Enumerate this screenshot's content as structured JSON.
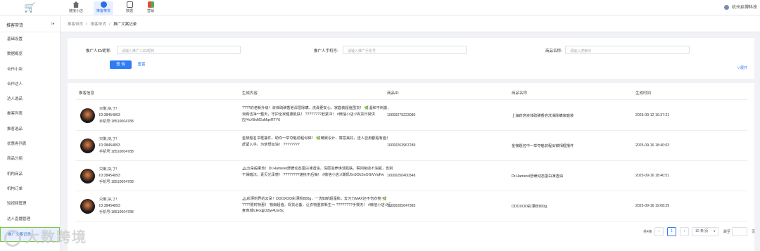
{
  "topbar": {
    "logo_icon": "cart-icon",
    "nav": [
      {
        "label": "链接小店",
        "icon": "home-icon"
      },
      {
        "label": "推客带货",
        "icon": "promo-icon",
        "active": true
      },
      {
        "label": "数据",
        "icon": "data-icon"
      },
      {
        "label": "营销",
        "icon": "marketing-icon"
      }
    ],
    "user_name": "杭州启博科技"
  },
  "sidebar": {
    "title": "推客带货",
    "collapse": "|◂",
    "items": [
      {
        "label": "基础设置"
      },
      {
        "label": "数据概览"
      },
      {
        "label": "合作小店"
      },
      {
        "label": "合作达人"
      },
      {
        "label": "达人选品"
      },
      {
        "label": "推客列表"
      },
      {
        "label": "推客选品"
      },
      {
        "label": "优惠券列表"
      },
      {
        "label": "商品分组"
      },
      {
        "label": "机构商品"
      },
      {
        "label": "机构订单"
      },
      {
        "label": "短视频管理"
      },
      {
        "label": "达人直播管理"
      },
      {
        "label": "推广文案记录",
        "active": true
      }
    ]
  },
  "breadcrumb": {
    "a": "推客带货",
    "sep": "/",
    "b": "推客带货",
    "c": "推广文案记录"
  },
  "filter": {
    "f1_label": "推广人ID/昵称:",
    "f1_placeholder": "请输入推广人ID/昵称",
    "f2_label": "推广人手机号:",
    "f2_placeholder": "请输入推广手机号",
    "f3_label": "商品名称:",
    "f3_placeholder": "请输入搜索ID",
    "query": "查 询",
    "reset": "重置",
    "expand": "∨展开"
  },
  "table": {
    "headers": [
      "推客信息",
      "生成内容",
      "商品ID",
      "商品名称",
      "生成时间"
    ],
    "rows": [
      {
        "name": "只剩,块,了!",
        "id": "ID:38454893",
        "phone": "手机号:18510004788",
        "content": "????的老新升级！液体硫磺香皂深层除螨、洗澡更安心，家庭装超值囤货！ 🌿温和不刺激，滑爽洁净一整天，守护全家健康肌肤！ ????????赶紧冲！ #微信小店://百货日常供应/4cXllnM2uMqeRTY6",
        "product_id": "10000279223080",
        "product_name": "上海药皂液体硫磺香皂洗澡除螨家庭装",
        "time": "2025-09-12 16:37:21"
      },
      {
        "name": "只剩,块,了!",
        "id": "ID:38454893",
        "phone": "手机号:18510004788",
        "content": "金柳题名书框摆件，助你一举夺魁前程似锦！ 🌿精致设计，寓意美好，送人自用都超有面！ 赶紧入手，为梦想加油！ ????????",
        "product_id": "10000263967289",
        "product_name": "金榜题名中一举夺魁前程似锦相框摆件",
        "time": "2025-09-16 18:40:03"
      },
      {
        "name": "只剩,块,了!",
        "id": "ID:38454893",
        "phone": "手机号:18510004788",
        "content": "🏔云朵般柔软！Dr.Hamerel舒缓动态蛋白凍透油，深层滋养焕活肌肤。瞬间吸收不油腻，告别干燥暗沉，素贝光泽感！ ????????速抢不后悔！ #微信小店://潮现/5n9OkSnOGiVVqFw",
        "product_id": "10000250400348",
        "product_name": "Dr.Hamerel舒缓动态蛋白凍透油",
        "time": "2025-09-16 18:40:51"
      },
      {
        "name": "只剩,块,了!",
        "id": "ID:38454893",
        "phone": "手机号:18510004788",
        "content": "🏔彩漂粉界的云朵！DDOXOO彩漂粉800g，一洗如新超温和，去污力MAX还不伤衣物 🌿 ????限时特惠！ 物南超值，现货必备，让衣物重获新生～ ????????手慢无！ #微信小店://汇麦商城/cHoqjjO2jw4UwSc",
        "product_id": "10000285647385",
        "product_name": "DDOXOO彩漂粉800g",
        "time": "2025-09-16 19:08:29"
      }
    ]
  },
  "pager": {
    "total": "共4条",
    "prev": "‹",
    "page": "1",
    "next": "›",
    "page_size": "10 条/页",
    "page_size_arrow": "∨",
    "goto_label": "跳至",
    "goto_value": "",
    "goto_unit": "页"
  },
  "watermark": "大数跨境"
}
